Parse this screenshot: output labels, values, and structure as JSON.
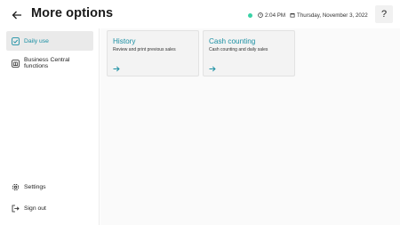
{
  "header": {
    "title": "More options",
    "status_color": "#39d2a6",
    "time": "2:04 PM",
    "date": "Thursday, November 3, 2022",
    "help_label": "?"
  },
  "sidebar": {
    "items": [
      {
        "label": "Daily use",
        "icon": "check-square-icon",
        "selected": true
      },
      {
        "label": "Business Central functions",
        "icon": "bank-icon",
        "selected": false
      }
    ],
    "bottom": [
      {
        "label": "Settings",
        "icon": "gear-icon"
      },
      {
        "label": "Sign out",
        "icon": "sign-out-icon"
      }
    ]
  },
  "cards": [
    {
      "title": "History",
      "description": "Review and print previous sales",
      "icon": "arrow-right-icon"
    },
    {
      "title": "Cash counting",
      "description": "Cash counting and daily sales",
      "icon": "arrow-right-icon"
    }
  ],
  "colors": {
    "accent": "#1a8fa3",
    "selected_bg": "#eaeaea"
  }
}
